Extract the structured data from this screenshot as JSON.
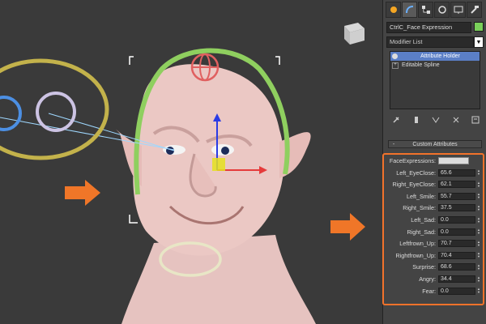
{
  "viewport": {
    "name": "3D viewport",
    "cube_label": "FRONT"
  },
  "panel": {
    "object_name": "CtrlC_Face Expression",
    "object_color": "#7ad05a",
    "modifier_list_label": "Modifier List",
    "stack": [
      {
        "label": "Attribute Holder",
        "selected": true
      },
      {
        "label": "Editable Spline",
        "selected": false
      }
    ],
    "rollout_title": "Custom Attributes",
    "rollout_toggle": "-",
    "attributes": [
      {
        "label": "FaceExpressions:",
        "value": "",
        "type": "text"
      },
      {
        "label": "Left_EyeClose:",
        "value": "65.6"
      },
      {
        "label": "Right_EyeClose:",
        "value": "62.1"
      },
      {
        "label": "Left_Smile:",
        "value": "55.7"
      },
      {
        "label": "Right_Smile:",
        "value": "37.5"
      },
      {
        "label": "Left_Sad:",
        "value": "0.0"
      },
      {
        "label": "Right_Sad:",
        "value": "0.0"
      },
      {
        "label": "Leftfrown_Up:",
        "value": "70.7"
      },
      {
        "label": "Rightfrown_Up:",
        "value": "70.4"
      },
      {
        "label": "Surprise:",
        "value": "68.6"
      },
      {
        "label": "Angry:",
        "value": "34.4"
      },
      {
        "label": "Fear:",
        "value": "0.0"
      }
    ]
  },
  "colors": {
    "highlight": "#f2722b",
    "selected": "#5b7fc6"
  }
}
